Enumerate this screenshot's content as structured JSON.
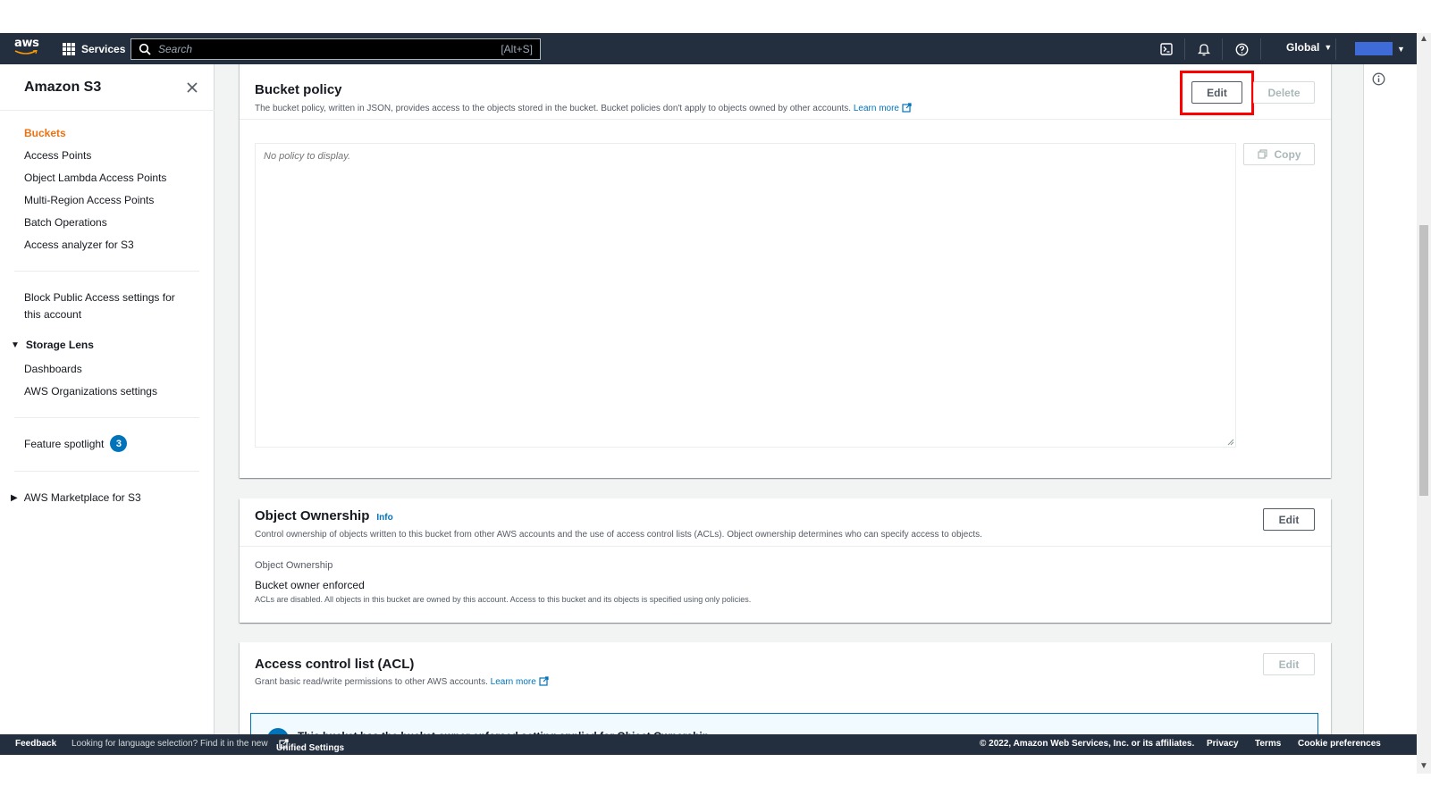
{
  "topnav": {
    "logo_text": "aws",
    "services_label": "Services",
    "search_placeholder": "Search",
    "search_shortcut": "[Alt+S]",
    "region_label": "Global",
    "account_color": "#3f6bd9"
  },
  "sidebar": {
    "title": "Amazon S3",
    "items": [
      {
        "label": "Buckets",
        "active": true
      },
      {
        "label": "Access Points"
      },
      {
        "label": "Object Lambda Access Points"
      },
      {
        "label": "Multi-Region Access Points"
      },
      {
        "label": "Batch Operations"
      },
      {
        "label": "Access analyzer for S3"
      }
    ],
    "block_public_access": "Block Public Access settings for this account",
    "storage_lens": {
      "label": "Storage Lens",
      "items": [
        {
          "label": "Dashboards"
        },
        {
          "label": "AWS Organizations settings"
        }
      ]
    },
    "feature_spotlight": {
      "label": "Feature spotlight",
      "count": "3"
    },
    "marketplace": "AWS Marketplace for S3"
  },
  "bucket_policy": {
    "title": "Bucket policy",
    "description": "The bucket policy, written in JSON, provides access to the objects stored in the bucket. Bucket policies don't apply to objects owned by other accounts.",
    "learn_more": "Learn more",
    "edit_label": "Edit",
    "delete_label": "Delete",
    "copy_label": "Copy",
    "policy_placeholder": "No policy to display."
  },
  "object_ownership": {
    "title": "Object Ownership",
    "info": "Info",
    "description": "Control ownership of objects written to this bucket from other AWS accounts and the use of access control lists (ACLs). Object ownership determines who can specify access to objects.",
    "edit_label": "Edit",
    "field_label": "Object Ownership",
    "field_value": "Bucket owner enforced",
    "field_desc": "ACLs are disabled. All objects in this bucket are owned by this account. Access to this bucket and its objects is specified using only policies."
  },
  "acl": {
    "title": "Access control list (ACL)",
    "description": "Grant basic read/write permissions to other AWS accounts.",
    "learn_more": "Learn more",
    "edit_label": "Edit",
    "alert_text": "This bucket has the bucket owner enforced setting applied for Object Ownership"
  },
  "footer": {
    "feedback": "Feedback",
    "language_msg": "Looking for language selection? Find it in the new",
    "unified_settings": "Unified Settings",
    "copyright": "© 2022, Amazon Web Services, Inc. or its affiliates.",
    "privacy": "Privacy",
    "terms": "Terms",
    "cookie": "Cookie preferences"
  },
  "colors": {
    "nav_bg": "#232f3e",
    "active_nav": "#ec7211",
    "link": "#0073bb",
    "highlight": "#ff0000"
  }
}
